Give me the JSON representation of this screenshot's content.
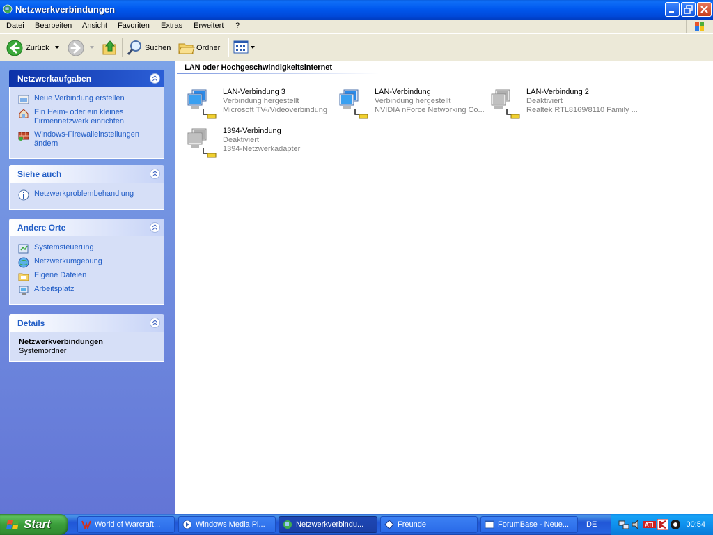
{
  "window": {
    "title": "Netzwerkverbindungen"
  },
  "menu": [
    "Datei",
    "Bearbeiten",
    "Ansicht",
    "Favoriten",
    "Extras",
    "Erweitert",
    "?"
  ],
  "toolbar": {
    "back_label": "Zurück",
    "search_label": "Suchen",
    "folders_label": "Ordner"
  },
  "taskpane": {
    "network_tasks": {
      "title": "Netzwerkaufgaben",
      "items": [
        {
          "label": "Neue Verbindung erstellen",
          "icon": "new-connection-icon"
        },
        {
          "label": "Ein Heim- oder ein kleines Firmennetzwerk einrichten",
          "icon": "home-network-icon"
        },
        {
          "label": "Windows-Firewalleinstellungen ändern",
          "icon": "firewall-icon"
        }
      ]
    },
    "see_also": {
      "title": "Siehe auch",
      "items": [
        {
          "label": "Netzwerkproblembehandlung",
          "icon": "info-icon"
        }
      ]
    },
    "other_places": {
      "title": "Andere Orte",
      "items": [
        {
          "label": "Systemsteuerung",
          "icon": "control-panel-icon"
        },
        {
          "label": "Netzwerkumgebung",
          "icon": "network-places-icon"
        },
        {
          "label": "Eigene Dateien",
          "icon": "my-documents-icon"
        },
        {
          "label": "Arbeitsplatz",
          "icon": "my-computer-icon"
        }
      ]
    },
    "details": {
      "title": "Details",
      "name": "Netzwerkverbindungen",
      "type": "Systemordner"
    }
  },
  "main": {
    "group_header": "LAN oder Hochgeschwindigkeitsinternet",
    "connections": [
      {
        "name": "LAN-Verbindung 3",
        "status": "Verbindung hergestellt",
        "device": "Microsoft TV-/Videoverbindung",
        "enabled": true
      },
      {
        "name": "LAN-Verbindung",
        "status": "Verbindung hergestellt",
        "device": "NVIDIA nForce Networking Co...",
        "enabled": true
      },
      {
        "name": "LAN-Verbindung 2",
        "status": "Deaktiviert",
        "device": "Realtek RTL8169/8110 Family ...",
        "enabled": false
      },
      {
        "name": "1394-Verbindung",
        "status": "Deaktiviert",
        "device": "1394-Netzwerkadapter",
        "enabled": false
      }
    ]
  },
  "taskbar": {
    "start_label": "Start",
    "tasks": [
      {
        "label": "World of Warcraft..."
      },
      {
        "label": "Windows Media Pl..."
      },
      {
        "label": "Netzwerkverbindu..."
      },
      {
        "label": "Freunde"
      },
      {
        "label": "ForumBase - Neue..."
      }
    ],
    "language": "DE",
    "clock": "00:54"
  }
}
